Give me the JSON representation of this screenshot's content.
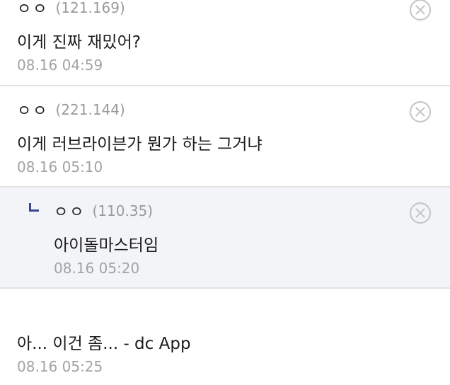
{
  "comments": [
    {
      "nickname": "ㅇㅇ",
      "ip": "(121.169)",
      "text": "이게 진짜 재밌어?",
      "date": "08.16 04:59",
      "delete_icon": "close-circle-icon"
    },
    {
      "nickname": "ㅇㅇ",
      "ip": "(221.144)",
      "text": "이게 러브라이븐가 뭔가 하는 그거냐",
      "date": "08.16 05:10",
      "delete_icon": "close-circle-icon"
    },
    {
      "nickname": "ㅇㅇ",
      "ip": "(110.35)",
      "text": "아이돌마스터임",
      "date": "08.16 05:20",
      "delete_icon": "close-circle-icon",
      "is_reply": true,
      "reply_icon": "reply-arrow-icon"
    },
    {
      "text": "아... 이건 좀... - dc App",
      "date": "08.16 05:25"
    }
  ],
  "colors": {
    "reply_bg": "#f2f4f8",
    "reply_mark": "#3b4890",
    "divider": "#e2e2e2",
    "meta_text": "#a3a3a3"
  }
}
